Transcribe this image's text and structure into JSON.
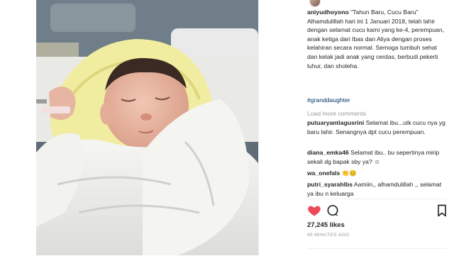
{
  "post": {
    "username": "aniyudhoyono",
    "caption": "\"Tahun Baru, Cucu Baru\" Alhamdulillah hari ini 1 Januari 2018, telah lahir dengan selamat cucu kami yang ke-4, perempuan, anak ketiga dari Ibas dan Aliya dengan proses kelahiran secara normal. Semoga tumbuh sehat dan kelak jadi anak yang cerdas, berbudi pekerti luhur, dan sholeha.",
    "hashtag": "#granddaughter",
    "load_more": "Load more comments",
    "likes": "27,245 likes",
    "time": "49 MINUTES AGO"
  },
  "comments": [
    {
      "user": "putuaryantiagusrini",
      "text": "Selamat ibu...utk cucu nya yg baru lahir. Senangnya dpt cucu perempuan."
    },
    {
      "user": "diana_emka46",
      "text": "Selamat ibu.. bu sepertinya mirip sekali dg bapak sby ya? ☺"
    },
    {
      "user": "wa_onefals",
      "text": "👏😊"
    },
    {
      "user": "putri_syarahlbs",
      "text": "Aamiin,, alhamdulillah ,, selamat ya ibu n keluarga"
    }
  ],
  "icons": {
    "like": "heart-icon",
    "comment": "comment-bubble-icon",
    "save": "bookmark-icon"
  },
  "colors": {
    "like_active": "#ed4956",
    "link": "#003569",
    "muted": "#999999",
    "text": "#262626"
  }
}
